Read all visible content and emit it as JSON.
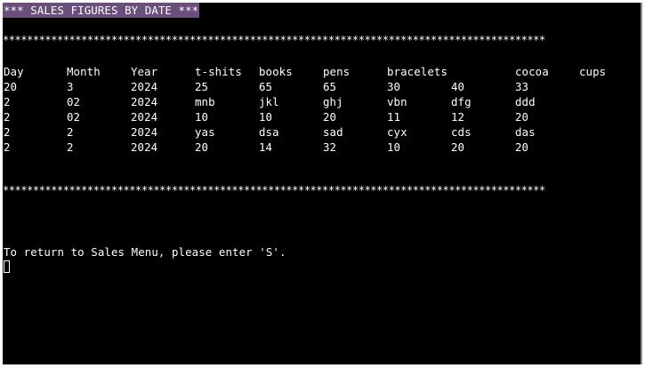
{
  "title": "*** SALES FIGURES BY DATE ***",
  "separator": "******************************************************************************************",
  "table": {
    "headers": [
      "Day",
      "Month",
      "Year",
      "t-shits",
      "books",
      "pens",
      "bracelets",
      "",
      "cocoa",
      "cups"
    ],
    "rows": [
      [
        "20",
        "3",
        "2024",
        "25",
        "65",
        "65",
        "30",
        "40",
        "33"
      ],
      [
        "2",
        "02",
        "2024",
        "mnb",
        "jkl",
        "ghj",
        "vbn",
        "dfg",
        "ddd"
      ],
      [
        "2",
        "02",
        "2024",
        "10",
        "10",
        "20",
        "11",
        "12",
        "20"
      ],
      [
        "2",
        "2",
        "2024",
        "yas",
        "dsa",
        "sad",
        "cyx",
        "cds",
        "das"
      ],
      [
        "2",
        "2",
        "2024",
        "20",
        "14",
        "32",
        "10",
        "20",
        "20"
      ]
    ]
  },
  "prompt": "To return to Sales Menu, please enter 'S'."
}
